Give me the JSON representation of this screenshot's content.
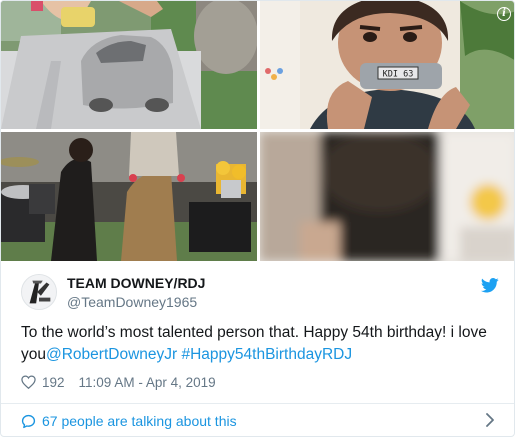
{
  "author": {
    "name": "TEAM DOWNEY/RDJ",
    "handle": "@TeamDowney1965"
  },
  "tweet": {
    "text_main": "To the world’s most talented person that. Happy 54th birthday! i love you",
    "mention": "@RobertDowneyJr",
    "hashtag": "#Happy54thBirthdayRDJ"
  },
  "meta": {
    "likes": "192",
    "timestamp": "11:09 AM - Apr 4, 2019"
  },
  "footer": {
    "talking": "67 people are talking about this"
  },
  "media": {
    "plate_text": "KDI 63"
  },
  "colors": {
    "link": "#1b95e0",
    "secondary_text": "#657786",
    "primary_text": "#14171a",
    "divider": "#e6ecf0"
  },
  "icons": [
    "info-icon",
    "twitter-bird-icon",
    "heart-icon",
    "speech-bubble-icon",
    "chevron-right-icon"
  ]
}
